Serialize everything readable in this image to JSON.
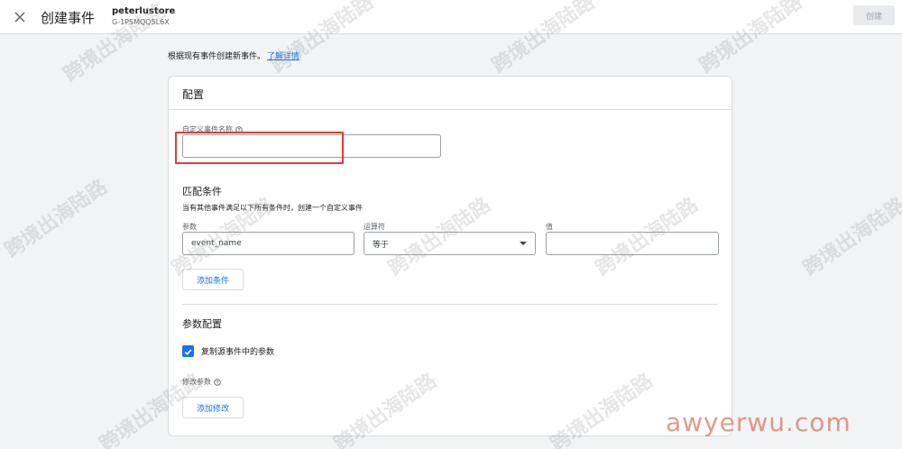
{
  "header": {
    "title": "创建事件",
    "property_name": "peterlustore",
    "property_id": "G-1PSMQQ5L6X",
    "create_label": "创建"
  },
  "intro": {
    "text": "根据现有事件创建新事件。",
    "link": "了解详情"
  },
  "config": {
    "title": "配置",
    "event_name_label": "自定义事件名称",
    "event_name_value": ""
  },
  "match": {
    "title": "匹配条件",
    "description": "当有其他事件满足以下所有条件时，创建一个自定义事件",
    "param_label": "参数",
    "param_value": "event_name",
    "operator_label": "运算符",
    "operator_value": "等于",
    "value_label": "值",
    "value_value": "",
    "add_condition_label": "添加条件"
  },
  "params": {
    "title": "参数配置",
    "copy_label": "复制源事件中的参数",
    "copy_checked": true,
    "modify_label": "修改参数",
    "add_modify_label": "添加修改"
  },
  "watermarks": {
    "text": "跨境出海陆路",
    "brand": "awyerwu.com"
  },
  "colors": {
    "accent": "#1a73e8",
    "highlight": "#e53935",
    "background": "#f1f3f4"
  },
  "icons": {
    "close": "close-icon",
    "help": "help-circle-icon",
    "dropdown": "arrow-drop-down-icon",
    "check": "check-icon"
  }
}
